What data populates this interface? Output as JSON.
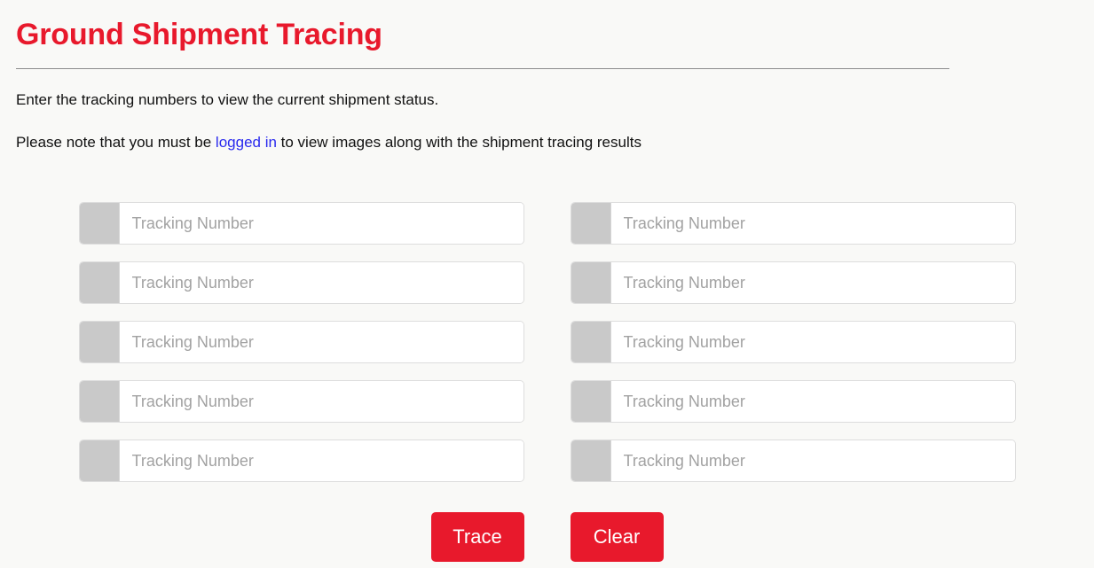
{
  "header": {
    "title": "Ground Shipment Tracing"
  },
  "intro": {
    "line1": "Enter the tracking numbers to view the current shipment status.",
    "line2_before": "Please note that you must be ",
    "line2_link": "logged in",
    "line2_after": " to view images along with the shipment tracing results"
  },
  "form": {
    "placeholder": "Tracking Number",
    "rows": [
      {
        "left": {
          "value": ""
        },
        "right": {
          "value": ""
        }
      },
      {
        "left": {
          "value": ""
        },
        "right": {
          "value": ""
        }
      },
      {
        "left": {
          "value": ""
        },
        "right": {
          "value": ""
        }
      },
      {
        "left": {
          "value": ""
        },
        "right": {
          "value": ""
        }
      },
      {
        "left": {
          "value": ""
        },
        "right": {
          "value": ""
        }
      }
    ]
  },
  "actions": {
    "trace_label": "Trace",
    "clear_label": "Clear"
  },
  "colors": {
    "brand_red": "#e8192c",
    "link_blue": "#2a2aee",
    "addon_gray": "#c9c9c9",
    "page_background": "#f9f9f7"
  }
}
